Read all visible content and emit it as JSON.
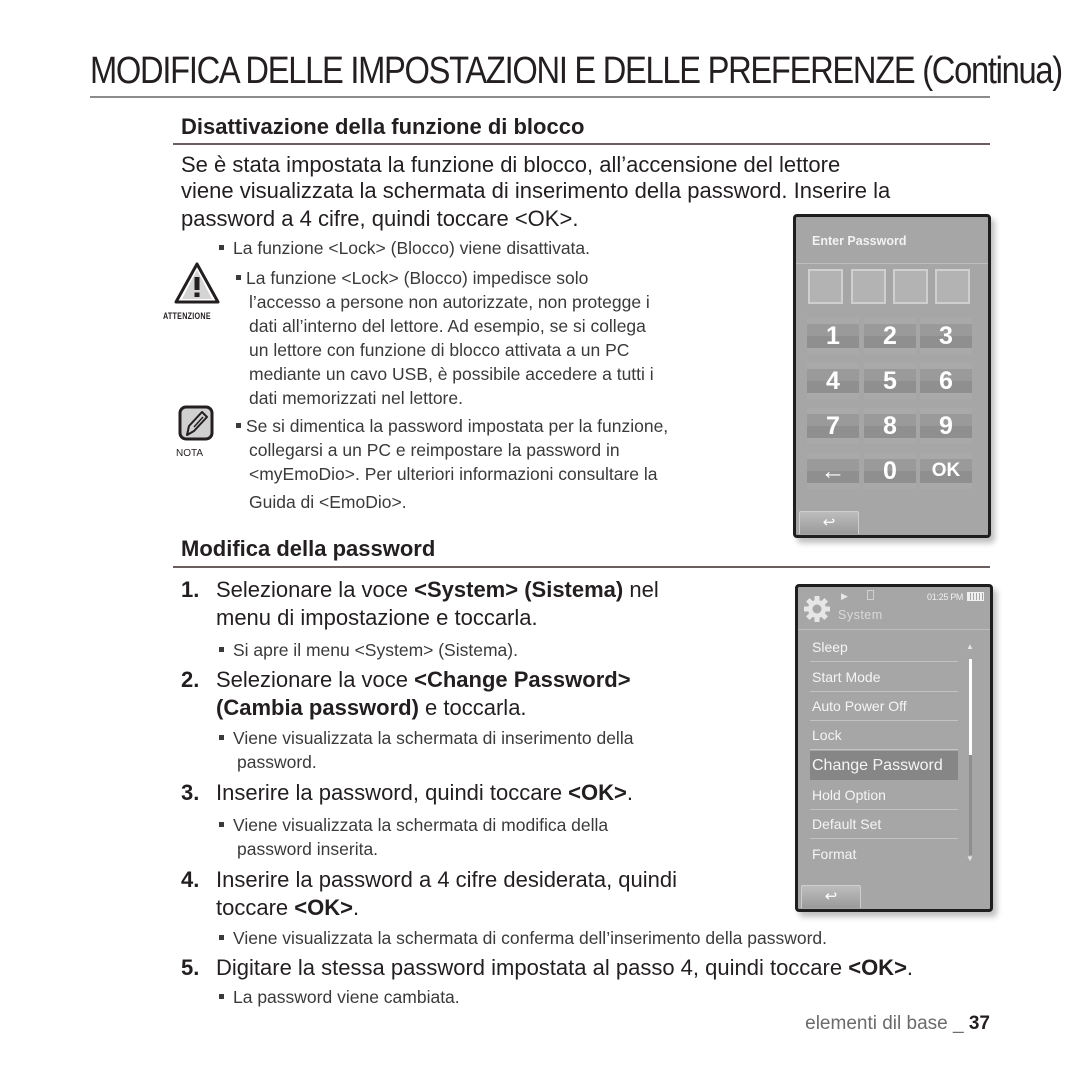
{
  "page": {
    "title": "MODIFICA DELLE IMPOSTAZIONI E DELLE PREFERENZE (Continua)"
  },
  "section1": {
    "heading": "Disattivazione della funzione di blocco",
    "intro_lines": [
      "Se è stata impostata la funzione di blocco, all’accensione del lettore",
      "viene visualizzata la schermata di inserimento della password. Inserire la",
      "password a 4 cifre, quindi toccare <OK>."
    ],
    "bullet": "La funzione <Lock> (Blocco) viene disattivata.",
    "warning": {
      "icon": "warning-triangle-icon",
      "label": "ATTENZIONE",
      "lines": [
        "La funzione <Lock> (Blocco) impedisce solo",
        "l’accesso a persone non autorizzate, non protegge i",
        "dati all’interno del lettore. Ad esempio, se si collega",
        "un lettore con funzione di blocco attivata a un PC",
        "mediante un cavo USB, è possibile accedere a tutti i",
        "dati memorizzati nel lettore."
      ]
    },
    "note": {
      "icon": "pencil-note-icon",
      "label": "NOTA",
      "lines": [
        "Se si dimentica la password impostata per la funzione,",
        "collegarsi a un PC e reimpostare la password in",
        "<myEmoDio>. Per ulteriori informazioni consultare la",
        "Guida di <EmoDio>."
      ]
    }
  },
  "password_screen": {
    "title": "Enter Password",
    "input_boxes": 4,
    "keys": [
      "1",
      "2",
      "3",
      "4",
      "5",
      "6",
      "7",
      "8",
      "9",
      "←",
      "0",
      "OK"
    ],
    "back_icon": "↩"
  },
  "section2": {
    "heading": "Modifica della password",
    "steps": [
      {
        "num": "1.",
        "line1_pre": "Selezionare la voce ",
        "line1_bold": "<System> (Sistema)",
        "line1_post": " nel",
        "line2": "menu di impostazione e toccarla.",
        "bullet": "Si apre il menu <System> (Sistema)."
      },
      {
        "num": "2.",
        "line1_pre": "Selezionare la voce ",
        "line1_bold": "<Change Password>",
        "line2_bold": "(Cambia password)",
        "line2_post": " e toccarla.",
        "bullet_lines": [
          "Viene visualizzata la schermata di inserimento della",
          "password."
        ]
      },
      {
        "num": "3.",
        "line1_pre": "Inserire la password, quindi toccare ",
        "line1_bold": "<OK>",
        "line1_post": ".",
        "bullet_lines": [
          "Viene visualizzata la schermata di modifica della",
          "password inserita."
        ]
      },
      {
        "num": "4.",
        "line1": "Inserire la password a 4 cifre desiderata, quindi",
        "line2_pre": "toccare ",
        "line2_bold": "<OK>",
        "line2_post": ".",
        "bullet": "Viene visualizzata la schermata di conferma dell’inserimento della password."
      },
      {
        "num": "5.",
        "line1_pre": "Digitare la stessa password impostata al passo 4, quindi toccare ",
        "line1_bold": "<OK>",
        "line1_post": ".",
        "bullet": "La password viene cambiata."
      }
    ]
  },
  "system_screen": {
    "title": "System",
    "time": "01:25 PM",
    "status_icons": [
      "play-icon",
      "lock-icon",
      "battery-icon"
    ],
    "menu_items": [
      "Sleep",
      "Start Mode",
      "Auto Power Off",
      "Lock",
      "Change Password",
      "Hold Option",
      "Default Set",
      "Format"
    ],
    "selected_index": 4,
    "back_icon": "↩"
  },
  "footer": {
    "section": "elementi dil base _ ",
    "page_number": "37"
  }
}
